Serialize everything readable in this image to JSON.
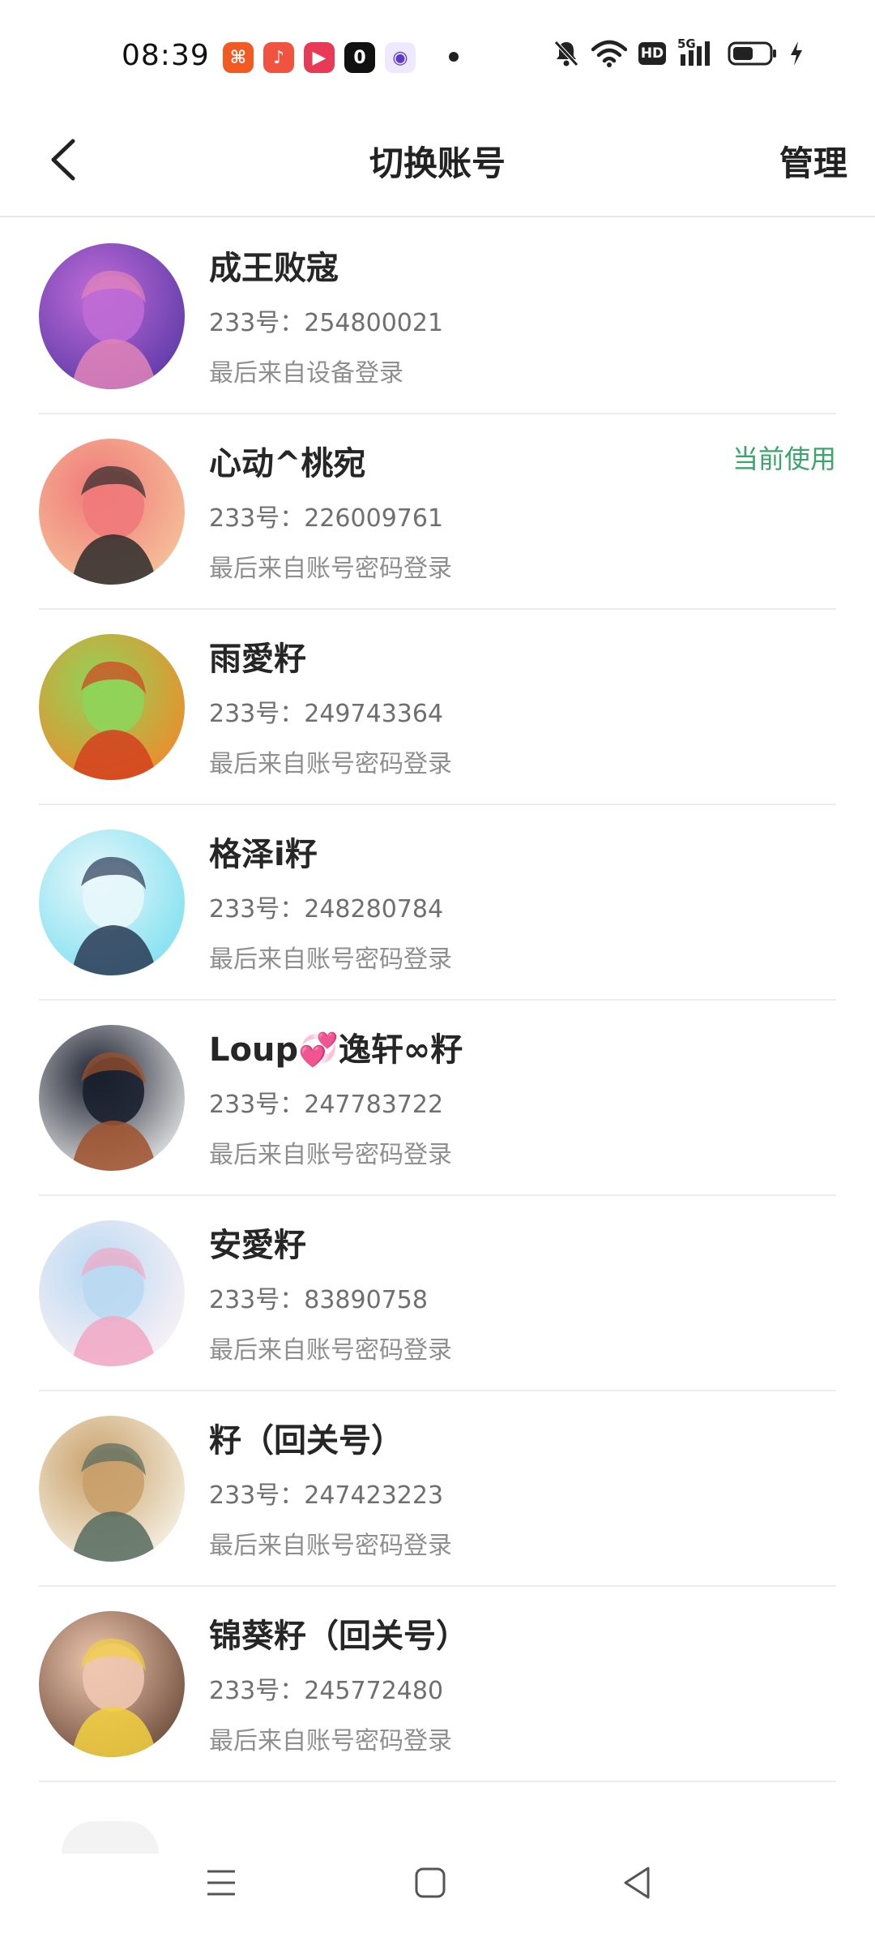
{
  "status_bar": {
    "time": "08:39",
    "apps": [
      {
        "icon": "orange-app-icon",
        "color": "#f25a24",
        "glyph": "⌘"
      },
      {
        "icon": "music-app-icon",
        "color": "#f0533f",
        "glyph": "♪"
      },
      {
        "icon": "video-app-icon",
        "color": "#e83a56",
        "glyph": "▶"
      },
      {
        "icon": "black-app-icon",
        "color": "#111111",
        "glyph": "0"
      },
      {
        "icon": "purple-app-icon",
        "color": "#efe9ff",
        "glyph": "◉"
      }
    ],
    "icons": [
      "muted-bell-icon",
      "wifi-icon",
      "hd-icon",
      "5g-signal-icon",
      "battery-icon",
      "charging-icon"
    ],
    "hd_text": "HD",
    "net_text": "5G"
  },
  "header": {
    "back_icon": "back-chevron-icon",
    "title": "切换账号",
    "manage_label": "管理"
  },
  "accounts": [
    {
      "name": "成王败寇",
      "id_text": "233号：254800021",
      "login_text": "最后来自设备登录",
      "current_label": "",
      "avatar_colors": [
        "#5b3aa8",
        "#c06bd6",
        "#e184b8"
      ]
    },
    {
      "name": "心动^桃宛",
      "id_text": "233号：226009761",
      "login_text": "最后来自账号密码登录",
      "current_label": "当前使用",
      "avatar_colors": [
        "#f6c39a",
        "#f07a7a",
        "#2b2b2b"
      ]
    },
    {
      "name": "雨愛籽",
      "id_text": "233号：249743364",
      "login_text": "最后来自账号密码登录",
      "current_label": "",
      "avatar_colors": [
        "#f08a2a",
        "#8fd45a",
        "#d4401f"
      ]
    },
    {
      "name": "格泽i籽",
      "id_text": "233号：248280784",
      "login_text": "最后来自账号密码登录",
      "current_label": "",
      "avatar_colors": [
        "#7ee0f0",
        "#e8f7fb",
        "#2a3a55"
      ]
    },
    {
      "name": "Loup💞逸轩∞籽",
      "id_text": "233号：247783722",
      "login_text": "最后来自账号密码登录",
      "current_label": "",
      "avatar_colors": [
        "#e8e8e8",
        "#1a1f2e",
        "#a0522d"
      ]
    },
    {
      "name": "安愛籽",
      "id_text": "233号：83890758",
      "login_text": "最后来自账号密码登录",
      "current_label": "",
      "avatar_colors": [
        "#fdf2f6",
        "#b9d9f2",
        "#f2a7c3"
      ]
    },
    {
      "name": "籽（回关号）",
      "id_text": "233号：247423223",
      "login_text": "最后来自账号密码登录",
      "current_label": "",
      "avatar_colors": [
        "#f7f3e6",
        "#c9a06a",
        "#556b5f"
      ]
    },
    {
      "name": "锦葵籽（回关号）",
      "id_text": "233号：245772480",
      "login_text": "最后来自账号密码登录",
      "current_label": "",
      "avatar_colors": [
        "#6b4a3a",
        "#f0c8b0",
        "#f2d040"
      ]
    }
  ],
  "system_nav": {
    "icons": [
      "menu-icon",
      "home-icon",
      "back-triangle-icon"
    ]
  }
}
